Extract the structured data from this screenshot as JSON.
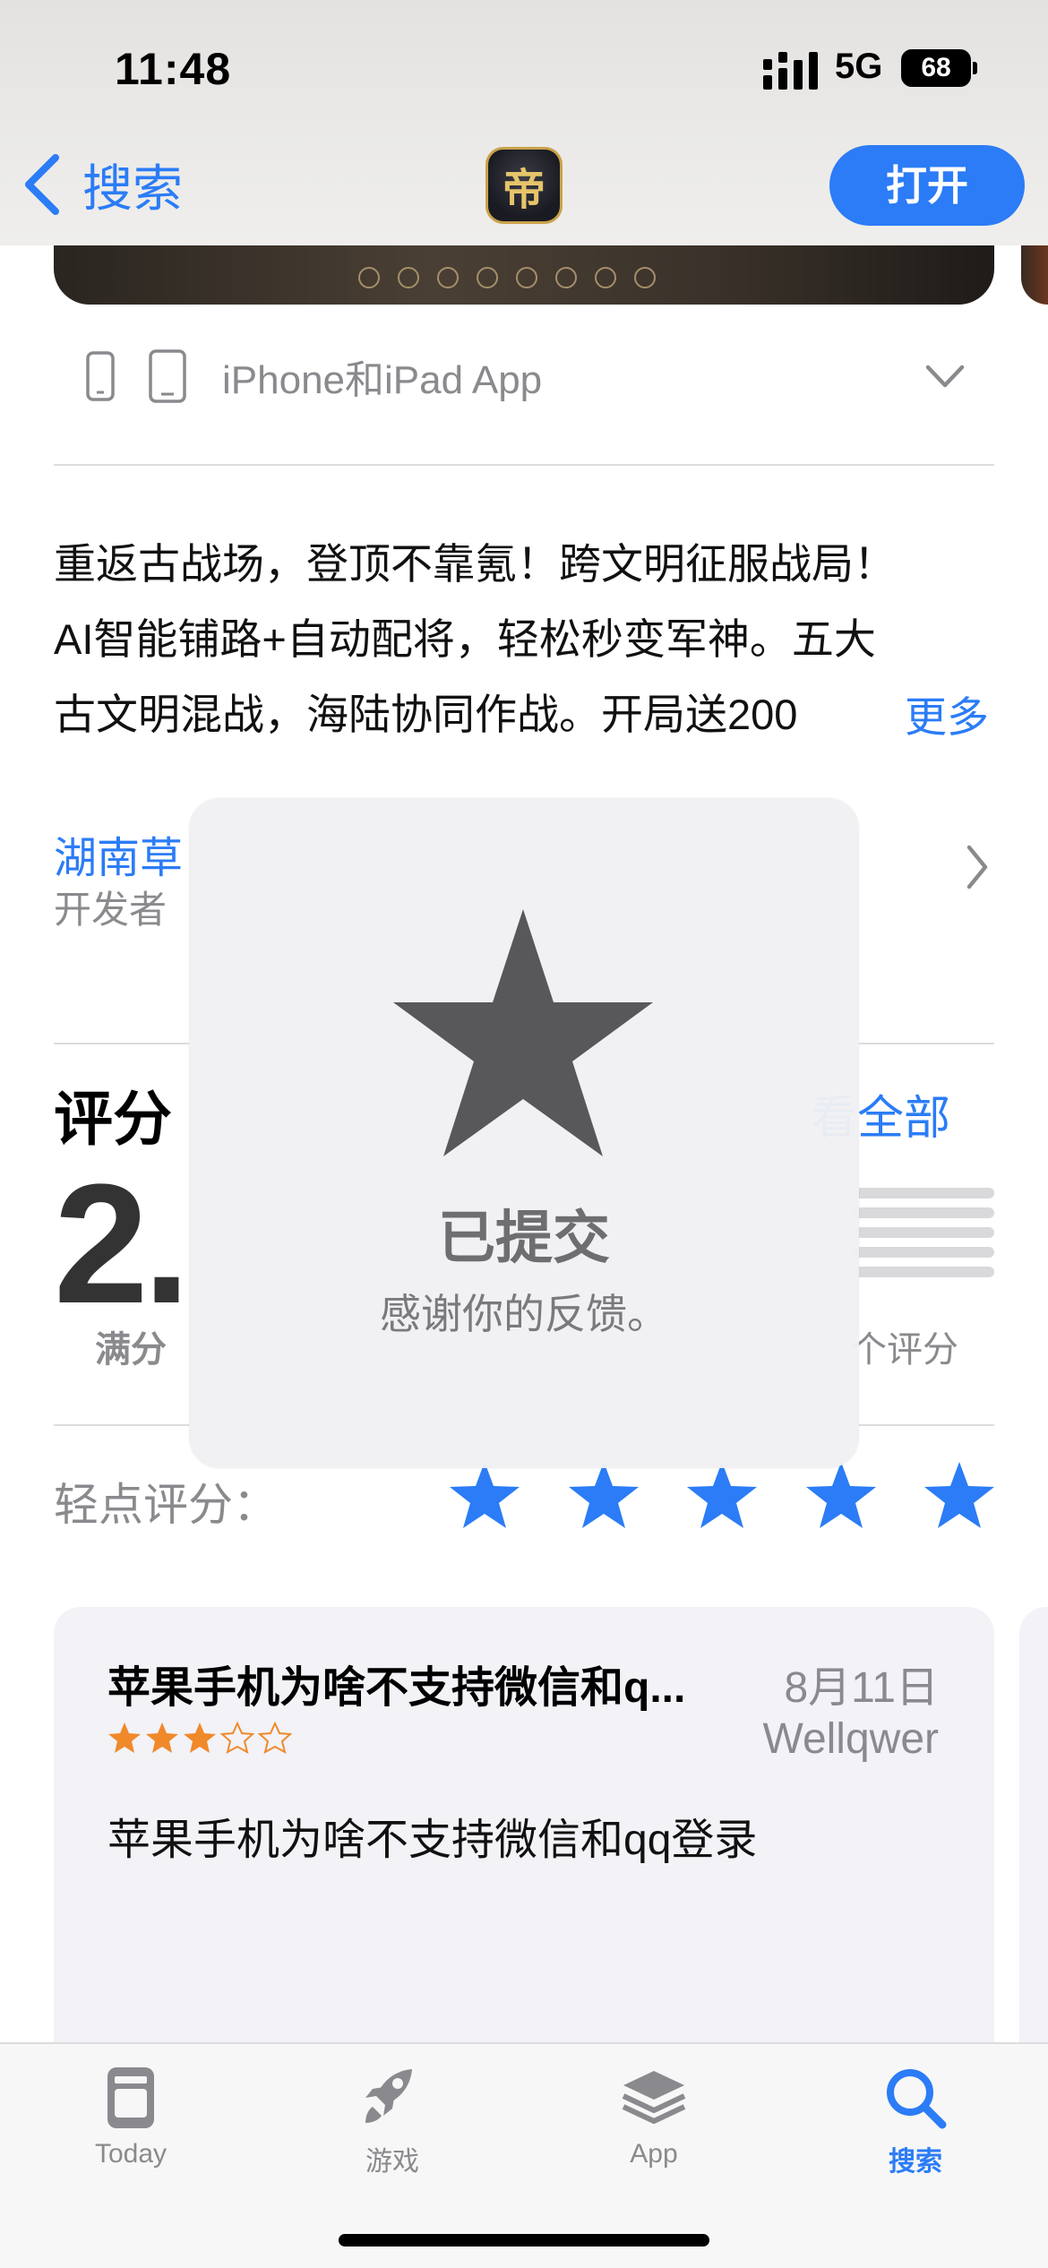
{
  "status_bar": {
    "time": "11:48",
    "network": "5G",
    "battery": "68"
  },
  "nav": {
    "back_label": "搜索",
    "app_icon_char": "帝",
    "open_label": "打开"
  },
  "device": {
    "label": "iPhone和iPad App"
  },
  "description": {
    "lines": [
      "重返古战场，登顶不靠氪！跨文明征服战局！",
      "AI智能铺路+自动配将，轻松秒变军神。五大",
      "古文明混战，海陆协同作战。开局送200"
    ],
    "more_label": "更多"
  },
  "developer": {
    "name": "湖南草",
    "sub": "开发者"
  },
  "ratings": {
    "title": "评分",
    "see_all": "看全部",
    "score": "2.",
    "max_label": "满分",
    "count_label": "个评分"
  },
  "tap_to_rate": {
    "label": "轻点评分：",
    "star_count": 5,
    "color": "#2b7cf6"
  },
  "review": {
    "title": "苹果手机为啥不支持微信和q...",
    "date": "8月11日",
    "author": "Wellqwer",
    "rating": 3,
    "body": "苹果手机为啥不支持微信和qq登录",
    "star_color": "#f0892a"
  },
  "tabs": [
    {
      "label": "Today",
      "icon": "today-icon"
    },
    {
      "label": "游戏",
      "icon": "rocket-icon"
    },
    {
      "label": "App",
      "icon": "apps-stack-icon"
    },
    {
      "label": "搜索",
      "icon": "search-icon",
      "active": true
    }
  ],
  "hud": {
    "title": "已提交",
    "subtitle": "感谢你的反馈。",
    "icon": "star-icon"
  },
  "colors": {
    "accent": "#2b7cf6",
    "card_bg": "#f2f2f7"
  }
}
